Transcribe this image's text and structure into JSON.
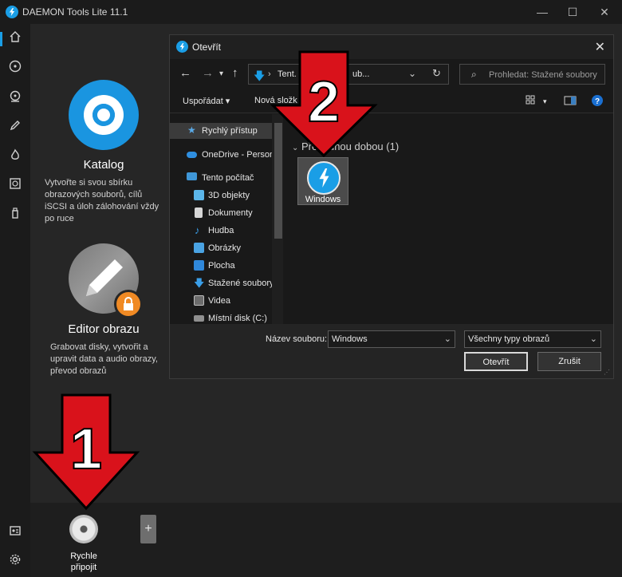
{
  "app": {
    "title": "DAEMON Tools Lite 11.1"
  },
  "window_controls": {
    "minimize": "—",
    "maximize": "☐",
    "close": "✕"
  },
  "rail": {
    "items": [
      "home-icon",
      "disc-icon",
      "search-image-icon",
      "pencil-icon",
      "flame-icon",
      "drive-icon",
      "usb-icon",
      "id-card-icon",
      "gear-icon"
    ]
  },
  "cards": {
    "katalog": {
      "title": "Katalog",
      "desc": "Vytvořte si svou sbírku obrazových souborů, cílů iSCSI a úloh zálohování vždy po ruce"
    },
    "editor": {
      "title": "Editor obrazu",
      "desc": "Grabovat disky, vytvořit a upravit data a audio obrazy, převod obrazů"
    }
  },
  "bottom": {
    "quick_mount": "Rychle připojit",
    "add": "+"
  },
  "dialog": {
    "title": "Otevřít",
    "close": "✕",
    "address_part1": "Tent.",
    "address_part2": "ub...",
    "search_placeholder": "Prohledat: Stažené soubory",
    "organize": "Uspořádat ▾",
    "new_folder": "Nová složk",
    "nav": [
      {
        "label": "Rychlý přístup",
        "icon": "star-icon"
      },
      {
        "label": "OneDrive - Person",
        "icon": "cloud-icon"
      },
      {
        "label": "Tento počítač",
        "icon": "computer-icon"
      },
      {
        "label": "3D objekty",
        "icon": "cube-icon"
      },
      {
        "label": "Dokumenty",
        "icon": "document-icon"
      },
      {
        "label": "Hudba",
        "icon": "music-icon"
      },
      {
        "label": "Obrázky",
        "icon": "picture-icon"
      },
      {
        "label": "Plocha",
        "icon": "desktop-icon"
      },
      {
        "label": "Stažené soubory",
        "icon": "download-icon"
      },
      {
        "label": "Videa",
        "icon": "video-icon"
      },
      {
        "label": "Místní disk (C:)",
        "icon": "disk-icon"
      }
    ],
    "group_header": "Pře        louhou dobou (1)",
    "file": {
      "name": "Windows"
    },
    "filename_label": "Název souboru:",
    "filename_value": "Windows",
    "filetype_value": "Všechny typy obrazů",
    "open_button": "Otevřít",
    "cancel_button": "Zrušit"
  },
  "annotations": {
    "arrow1": "1",
    "arrow2": "2"
  },
  "colors": {
    "accent": "#1a9ee6",
    "arrow_red": "#d9121b",
    "lock_orange": "#f08a24"
  }
}
